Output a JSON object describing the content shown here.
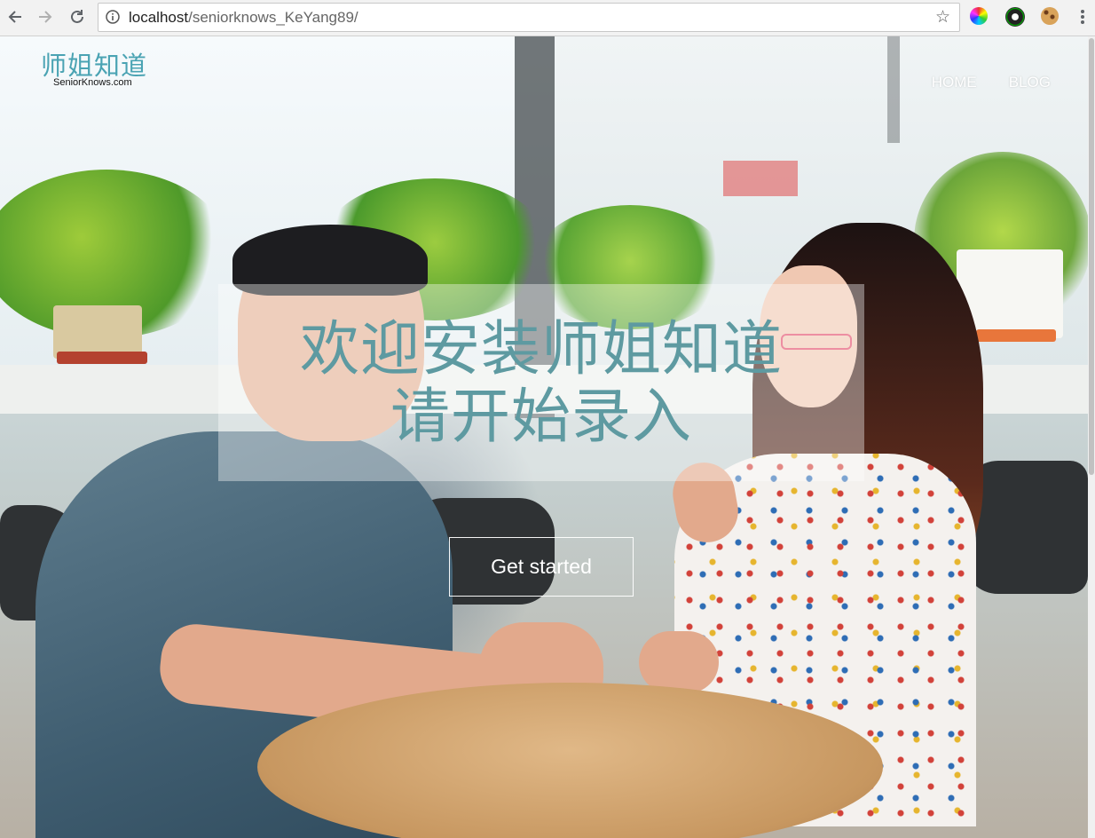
{
  "browser": {
    "url_host": "localhost",
    "url_path": "/seniorknows_KeYang89/"
  },
  "site": {
    "logo_cn": "师姐知道",
    "logo_en": "SeniorKnows.com",
    "nav": [
      {
        "label": "HOME"
      },
      {
        "label": "BLOG"
      }
    ]
  },
  "hero": {
    "headline_line1": "欢迎安装师姐知道",
    "headline_line2": "请开始录入",
    "cta_label": "Get started"
  },
  "colors": {
    "accent": "#5e9aa1",
    "logo": "#4aa3b3"
  }
}
